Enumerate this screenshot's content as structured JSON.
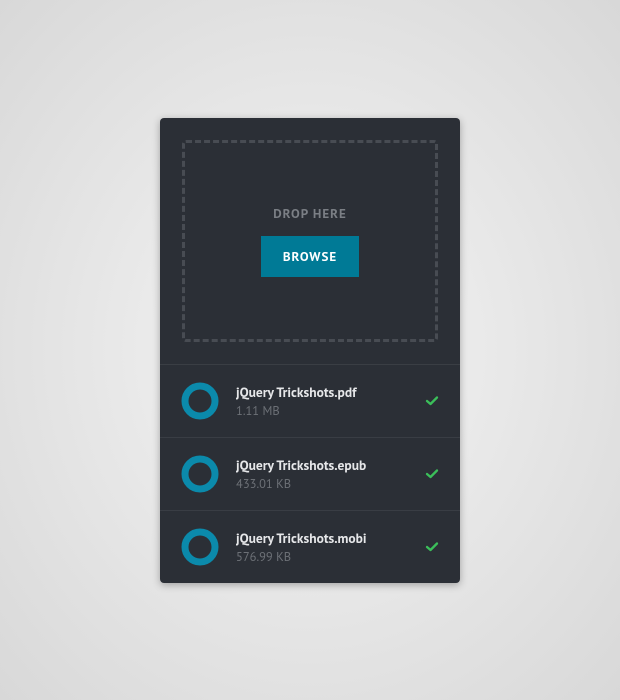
{
  "dropzone": {
    "label": "DROP HERE",
    "browse_label": "BROWSE"
  },
  "colors": {
    "accent": "#007a96",
    "ring": "#0b8aab",
    "success": "#3bbf5a",
    "panel": "#2b2f36"
  },
  "files": [
    {
      "name": "jQuery Trickshots.pdf",
      "size": "1.11 MB",
      "complete": true
    },
    {
      "name": "jQuery Trickshots.epub",
      "size": "433.01 KB",
      "complete": true
    },
    {
      "name": "jQuery Trickshots.mobi",
      "size": "576.99 KB",
      "complete": true
    }
  ]
}
